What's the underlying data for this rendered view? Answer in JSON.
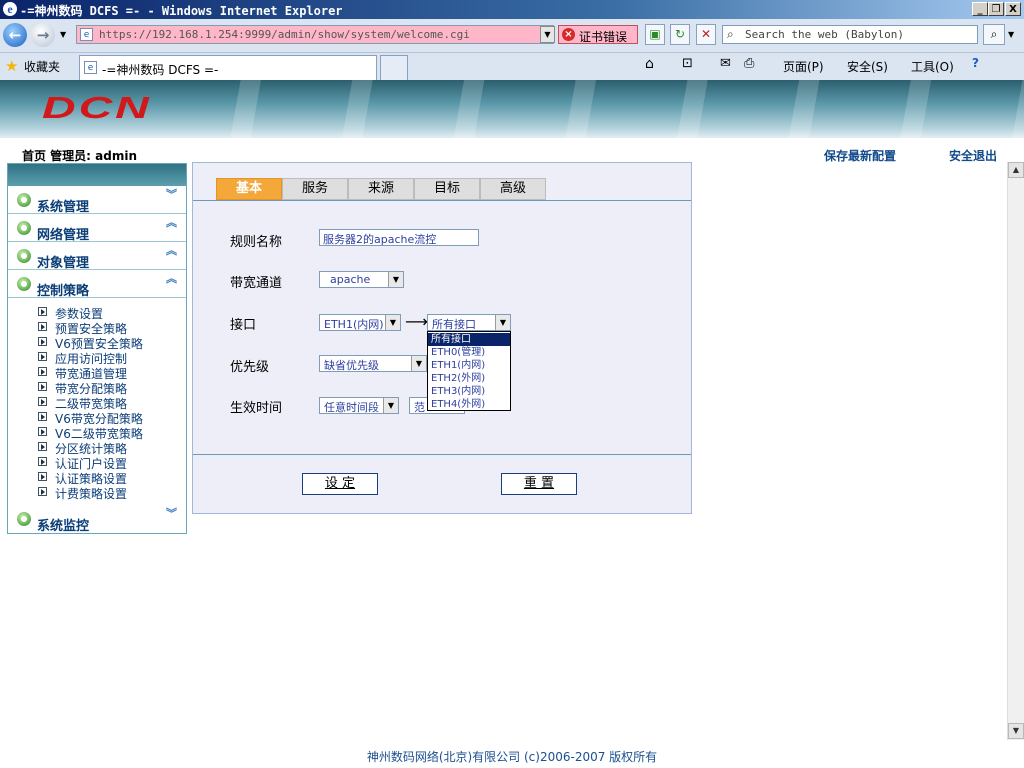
{
  "window": {
    "title": "-=神州数码 DCFS =- - Windows Internet Explorer",
    "minimize_icon": "_",
    "restore_icon": "❐",
    "close_icon": "X"
  },
  "nav": {
    "url": "https://192.168.1.254:9999/admin/show/system/welcome.cgi",
    "cert_error": "证书错误",
    "search_placeholder": "Search the web (Babylon)"
  },
  "favorites": {
    "label": "收藏夹",
    "tab_title": "-=神州数码 DCFS =-",
    "page_menu": "页面(P)",
    "safety_menu": "安全(S)",
    "tools_menu": "工具(O)"
  },
  "header": {
    "logo": "DCN",
    "user_text": "首页  管理员: admin",
    "save_config": "保存最新配置",
    "logout": "安全退出"
  },
  "sidebar": {
    "sections": [
      {
        "label": "系统管理",
        "expanded": false
      },
      {
        "label": "网络管理",
        "expanded": true
      },
      {
        "label": "对象管理",
        "expanded": true
      },
      {
        "label": "控制策略",
        "expanded": true
      }
    ],
    "items": [
      "参数设置",
      "预置安全策略",
      "V6预置安全策略",
      "应用访问控制",
      "带宽通道管理",
      "带宽分配策略",
      "二级带宽策略",
      "V6带宽分配策略",
      "V6二级带宽策略",
      "分区统计策略",
      "认证门户设置",
      "认证策略设置",
      "计费策略设置"
    ],
    "last_section": {
      "label": "系统监控",
      "expanded": false
    }
  },
  "form": {
    "tabs": [
      "基本",
      "服务",
      "来源",
      "目标",
      "高级"
    ],
    "active_tab": 0,
    "rule_name_label": "规则名称",
    "rule_name_value": "服务器2的apache流控",
    "channel_label": "带宽通道",
    "channel_value": "apache",
    "interface_label": "接口",
    "interface_from": "ETH1(内网)",
    "interface_to": "所有接口",
    "interface_arrow": "⟶",
    "interface_options": [
      "所有接口",
      "ETH0(管理)",
      "ETH1(内网)",
      "ETH2(外网)",
      "ETH3(内网)",
      "ETH4(外网)"
    ],
    "priority_label": "优先级",
    "priority_value": "缺省优先级",
    "time_label": "生效时间",
    "time_value": "任意时间段",
    "time_extra": "范",
    "set_button": "设 定",
    "reset_button": "重 置"
  },
  "footer": {
    "copyright": "神州数码网络(北京)有限公司 (c)2006-2007 版权所有"
  },
  "colors": {
    "active_tab": "#f4a83a",
    "sidebar_text": "#0b3d77",
    "cert_error_bg": "#ffb6c8",
    "logo": "#d1181a"
  }
}
